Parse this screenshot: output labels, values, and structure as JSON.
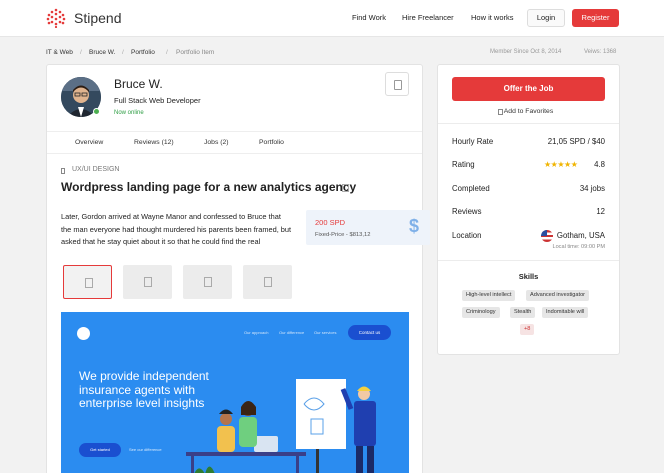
{
  "header": {
    "brand": "Stipend",
    "nav": [
      "Find Work",
      "Hire Freelancer",
      "How it works"
    ],
    "login": "Login",
    "register": "Register"
  },
  "breadcrumb": {
    "items": [
      "IT & Web",
      "Bruce W.",
      "Portfolio",
      "Portfolio Item"
    ],
    "member_since": "Member Since Oct 8, 2014",
    "views": "Veiws: 1368"
  },
  "profile": {
    "name": "Bruce W.",
    "role": "Full Stack Web Developer",
    "status": "Now online"
  },
  "tabs": [
    "Overview",
    "Reviews (12)",
    "Jobs (2)",
    "Portfolio"
  ],
  "item": {
    "category": "UX/UI DESIGN",
    "title": "Wordpress landing page for a new analytics agency",
    "description": "Later, Gordon arrived at Wayne Manor and confessed to Bruce that the man everyone had thought murdered his parents been framed, but asked that he stay quiet about it so that he could find the real",
    "price": "200 SPD",
    "price_note": "Fixed-Price - $813,12",
    "price_icon": "$"
  },
  "hero": {
    "nav": [
      "Our approach",
      "Our difference",
      "Our services"
    ],
    "contact": "Contact us",
    "headline": "We provide independent insurance agents with enterprise level insights",
    "cta": "Get started",
    "link": "See our difference"
  },
  "sidebar": {
    "offer_button": "Offer the Job",
    "favorites": "Add to Favorites",
    "hourly_rate_label": "Hourly Rate",
    "hourly_rate": "21,05 SPD / $40",
    "rating_label": "Rating",
    "stars": "★★★★★",
    "rating": "4.8",
    "completed_label": "Completed",
    "completed": "34 jobs",
    "reviews_label": "Reviews",
    "reviews": "12",
    "location_label": "Location",
    "location": "Gotham, USA",
    "local_time": "Local time: 09:00 PM",
    "skills_title": "Skills",
    "skills": [
      "High-level intellect",
      "Advanced investigator",
      "Criminology",
      "Stealth",
      "Indomitable will",
      "+8"
    ]
  },
  "colors": {
    "accent": "#e53a3a",
    "hero_blue": "#2b8cf0",
    "star": "#f0b400",
    "online": "#2e9e44"
  }
}
